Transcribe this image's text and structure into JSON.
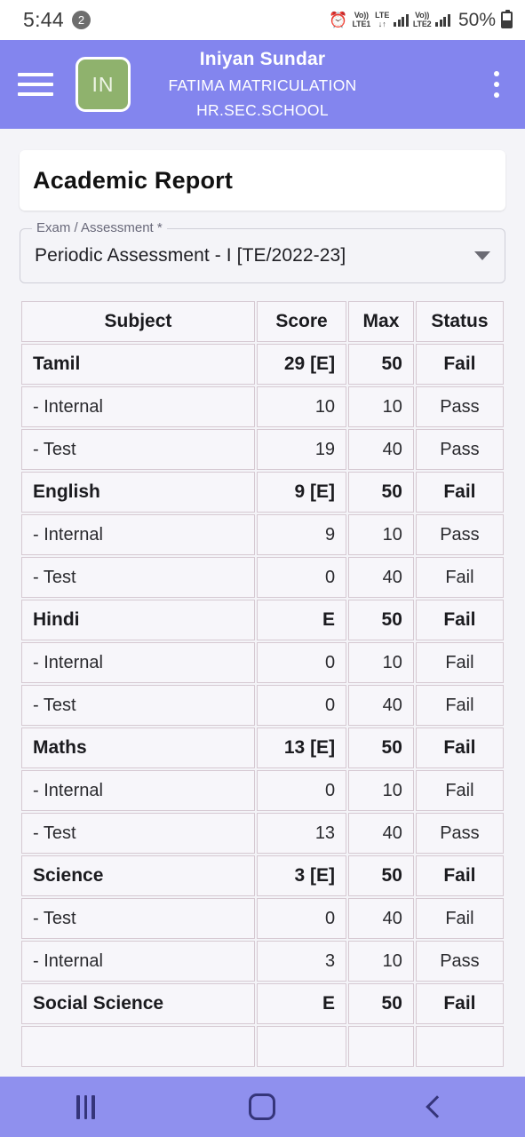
{
  "status_bar": {
    "time": "5:44",
    "notification_count": "2",
    "alarm_icon": "alarm-clock-icon",
    "sim1": {
      "volte": "Vo))",
      "label": "LTE1",
      "data_arrows": "↓↑"
    },
    "sim1_network": "LTE",
    "sim2": {
      "volte": "Vo))",
      "label": "LTE2"
    },
    "battery_percent": "50%"
  },
  "app_bar": {
    "menu_icon": "hamburger-menu-icon",
    "avatar_initials": "IN",
    "student_name": "Iniyan Sundar",
    "school_line1": "FATIMA MATRICULATION",
    "school_line2": "HR.SEC.SCHOOL",
    "overflow_icon": "more-vertical-icon",
    "accent_color": "#8385ee",
    "avatar_color": "#8fb26d"
  },
  "page": {
    "title": "Academic Report"
  },
  "exam_select": {
    "label": "Exam / Assessment *",
    "value": "Periodic Assessment - I [TE/2022-23]",
    "caret_icon": "chevron-down-icon"
  },
  "table": {
    "headers": [
      "Subject",
      "Score",
      "Max",
      "Status"
    ],
    "rows": [
      {
        "type": "main",
        "subject": "Tamil",
        "score": "29 [E]",
        "max": "50",
        "status": "Fail"
      },
      {
        "type": "sub",
        "subject": "- Internal",
        "score": "10",
        "max": "10",
        "status": "Pass"
      },
      {
        "type": "sub",
        "subject": "- Test",
        "score": "19",
        "max": "40",
        "status": "Pass"
      },
      {
        "type": "main",
        "subject": "English",
        "score": "9 [E]",
        "max": "50",
        "status": "Fail"
      },
      {
        "type": "sub",
        "subject": "- Internal",
        "score": "9",
        "max": "10",
        "status": "Pass"
      },
      {
        "type": "sub",
        "subject": "- Test",
        "score": "0",
        "max": "40",
        "status": "Fail"
      },
      {
        "type": "main",
        "subject": "Hindi",
        "score": "E",
        "max": "50",
        "status": "Fail"
      },
      {
        "type": "sub",
        "subject": "- Internal",
        "score": "0",
        "max": "10",
        "status": "Fail"
      },
      {
        "type": "sub",
        "subject": "- Test",
        "score": "0",
        "max": "40",
        "status": "Fail"
      },
      {
        "type": "main",
        "subject": "Maths",
        "score": "13 [E]",
        "max": "50",
        "status": "Fail"
      },
      {
        "type": "sub",
        "subject": "- Internal",
        "score": "0",
        "max": "10",
        "status": "Fail"
      },
      {
        "type": "sub",
        "subject": "- Test",
        "score": "13",
        "max": "40",
        "status": "Pass"
      },
      {
        "type": "main",
        "subject": "Science",
        "score": "3 [E]",
        "max": "50",
        "status": "Fail"
      },
      {
        "type": "sub",
        "subject": "- Test",
        "score": "0",
        "max": "40",
        "status": "Fail"
      },
      {
        "type": "sub",
        "subject": "- Internal",
        "score": "3",
        "max": "10",
        "status": "Pass"
      },
      {
        "type": "main",
        "subject": "Social Science",
        "score": "E",
        "max": "50",
        "status": "Fail"
      },
      {
        "type": "sub",
        "subject": "",
        "score": "",
        "max": "",
        "status": ""
      }
    ]
  },
  "nav_bar": {
    "recent_icon": "recent-apps-icon",
    "home_icon": "home-icon",
    "back_icon": "back-icon",
    "color": "#8f90ee"
  }
}
